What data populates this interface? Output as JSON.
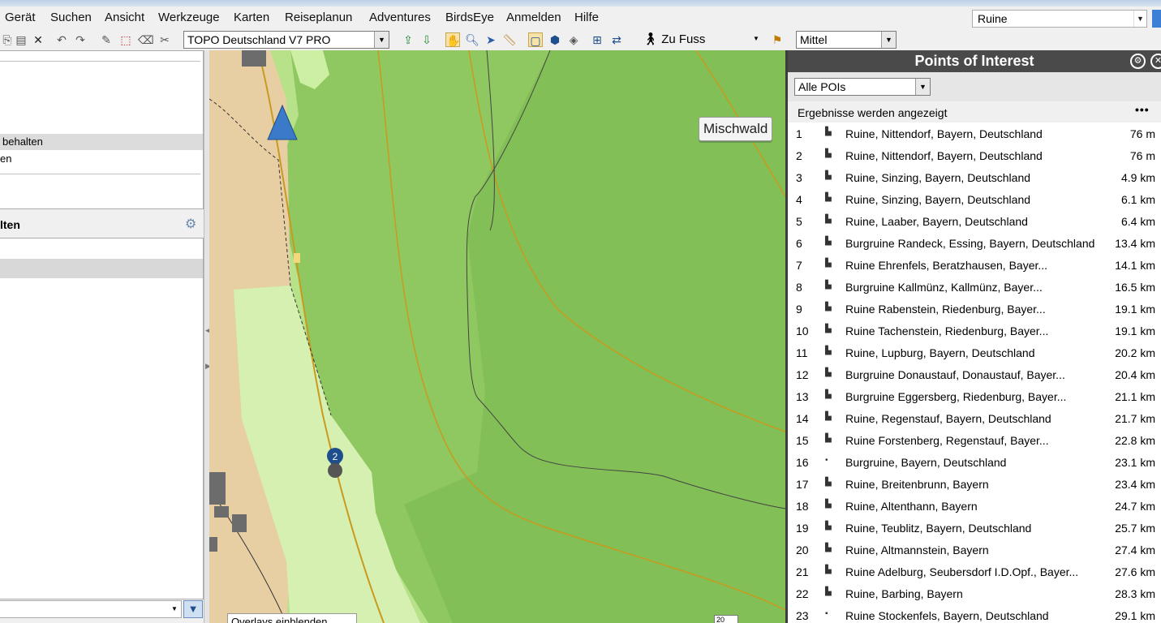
{
  "menu": [
    "Gerät",
    "Suchen",
    "Ansicht",
    "Werkzeuge",
    "Karten",
    "Reiseplanung",
    "Adventures",
    "BirdsEye",
    "Anmelden",
    "Hilfe"
  ],
  "search": {
    "value": "Ruine"
  },
  "toolbar": {
    "map_product": "TOPO Deutschland V7 PRO",
    "activity": "Zu Fuss",
    "detail_level": "Mittel"
  },
  "left_panel": {
    "selected_row": "behalten",
    "row_fragment": "en",
    "section_title": "lten"
  },
  "map": {
    "popup_label": "Mischwald",
    "waypoint_label": "2",
    "overlay_combo": "Overlays einblenden",
    "scale_label": "20"
  },
  "poi_panel": {
    "title": "Points of Interest",
    "filter": "Alle POIs",
    "status": "Ergebnisse werden angezeigt",
    "more": "•••",
    "items": [
      {
        "num": "1",
        "icon": "ruin-icon",
        "name": "Ruine, Nittendorf, Bayern, Deutschland",
        "dist": "76 m"
      },
      {
        "num": "2",
        "icon": "ruin-icon",
        "name": "Ruine, Nittendorf, Bayern, Deutschland",
        "dist": "76 m"
      },
      {
        "num": "3",
        "icon": "ruin-icon",
        "name": "Ruine, Sinzing, Bayern, Deutschland",
        "dist": "4.9 km"
      },
      {
        "num": "4",
        "icon": "ruin-icon",
        "name": "Ruine, Sinzing, Bayern, Deutschland",
        "dist": "6.1 km"
      },
      {
        "num": "5",
        "icon": "ruin-icon",
        "name": "Ruine, Laaber, Bayern, Deutschland",
        "dist": "6.4 km"
      },
      {
        "num": "6",
        "icon": "ruin-icon",
        "name": "Burgruine Randeck, Essing, Bayern, Deutschland",
        "dist": "13.4 km"
      },
      {
        "num": "7",
        "icon": "ruin-icon",
        "name": "Ruine Ehrenfels, Beratzhausen, Bayer...",
        "dist": "14.1 km"
      },
      {
        "num": "8",
        "icon": "ruin-icon",
        "name": "Burgruine Kallmünz, Kallmünz, Bayer...",
        "dist": "16.5 km"
      },
      {
        "num": "9",
        "icon": "ruin-icon",
        "name": "Ruine Rabenstein, Riedenburg, Bayer...",
        "dist": "19.1 km"
      },
      {
        "num": "10",
        "icon": "ruin-icon",
        "name": "Ruine Tachenstein, Riedenburg, Bayer...",
        "dist": "19.1 km"
      },
      {
        "num": "11",
        "icon": "ruin-icon",
        "name": "Ruine, Lupburg, Bayern, Deutschland",
        "dist": "20.2 km"
      },
      {
        "num": "12",
        "icon": "ruin-icon",
        "name": "Burgruine Donaustauf, Donaustauf, Bayer...",
        "dist": "20.4 km"
      },
      {
        "num": "13",
        "icon": "ruin-icon",
        "name": "Burgruine Eggersberg, Riedenburg, Bayer...",
        "dist": "21.1 km"
      },
      {
        "num": "14",
        "icon": "ruin-icon",
        "name": "Ruine, Regenstauf, Bayern, Deutschland",
        "dist": "21.7 km"
      },
      {
        "num": "15",
        "icon": "ruin-icon",
        "name": "Ruine Forstenberg, Regenstauf, Bayer...",
        "dist": "22.8 km"
      },
      {
        "num": "16",
        "icon": "dot-icon",
        "name": "Burgruine, Bayern, Deutschland",
        "dist": "23.1 km"
      },
      {
        "num": "17",
        "icon": "ruin-icon",
        "name": "Ruine, Breitenbrunn, Bayern",
        "dist": "23.4 km"
      },
      {
        "num": "18",
        "icon": "ruin-icon",
        "name": "Ruine, Altenthann, Bayern",
        "dist": "24.7 km"
      },
      {
        "num": "19",
        "icon": "ruin-icon",
        "name": "Ruine, Teublitz, Bayern, Deutschland",
        "dist": "25.7 km"
      },
      {
        "num": "20",
        "icon": "ruin-icon",
        "name": "Ruine, Altmannstein, Bayern",
        "dist": "27.4 km"
      },
      {
        "num": "21",
        "icon": "ruin-icon",
        "name": "Ruine Adelburg, Seubersdorf I.D.Opf., Bayer...",
        "dist": "27.6 km"
      },
      {
        "num": "22",
        "icon": "ruin-icon",
        "name": "Ruine, Barbing, Bayern",
        "dist": "28.3 km"
      },
      {
        "num": "23",
        "icon": "square-icon",
        "name": "Ruine Stockenfels, Bayern, Deutschland",
        "dist": "29.1 km"
      }
    ]
  }
}
